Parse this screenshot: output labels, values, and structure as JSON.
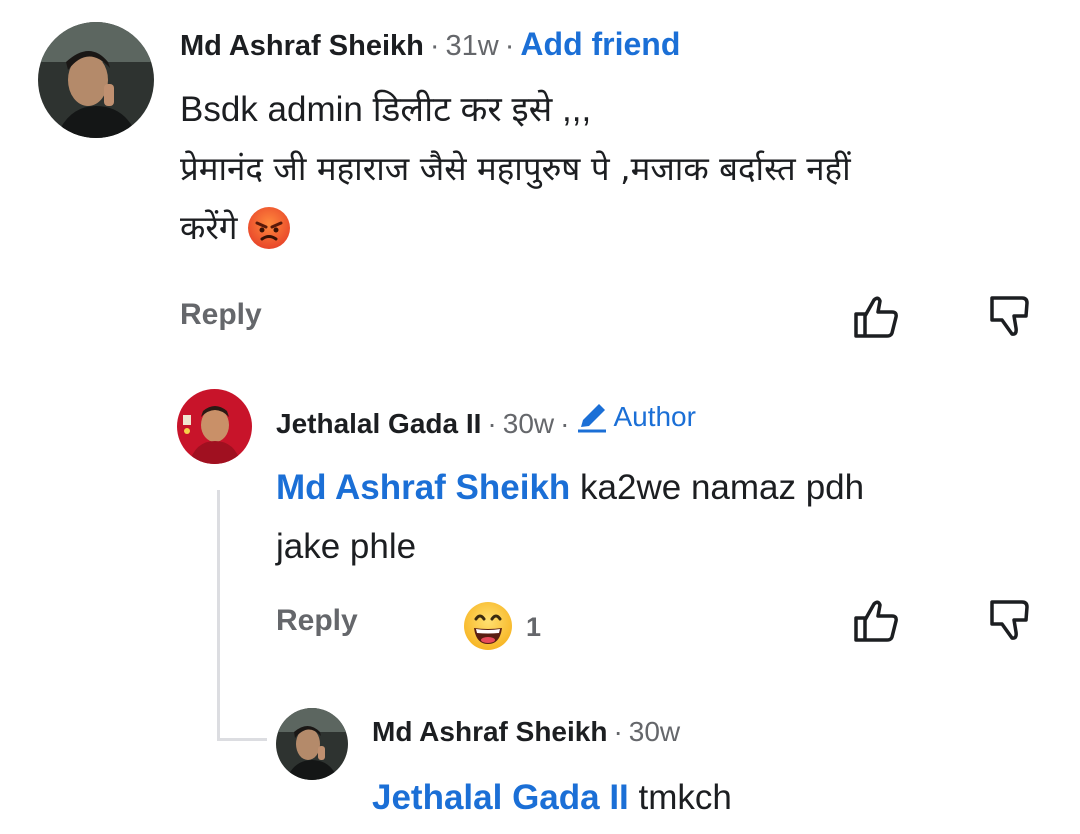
{
  "comments": [
    {
      "author": "Md Ashraf Sheikh",
      "time": "31w",
      "action": "Add friend",
      "lines": [
        "Bsdk admin डिलीट कर इसे ,,,",
        "प्रेमानंद जी महाराज जैसे महापुरुष पे ,मजाक बर्दास्त नहीं",
        "करेंगे"
      ],
      "emoji": "angry-face-emoji",
      "reply_label": "Reply"
    },
    {
      "author": "Jethalal Gada II",
      "time": "30w",
      "badge": "Author",
      "mention": "Md Ashraf Sheikh",
      "text_line1": "ka2we namaz pdh",
      "text_line2": "jake phle",
      "reply_label": "Reply",
      "reaction": "grinning-face-emoji",
      "reaction_count": "1"
    },
    {
      "author": "Md Ashraf Sheikh",
      "time": "30w",
      "mention": "Jethalal Gada II",
      "text": "tmkch"
    }
  ],
  "separator": "·",
  "icons": [
    "like-icon",
    "dislike-icon",
    "pencil-icon"
  ]
}
